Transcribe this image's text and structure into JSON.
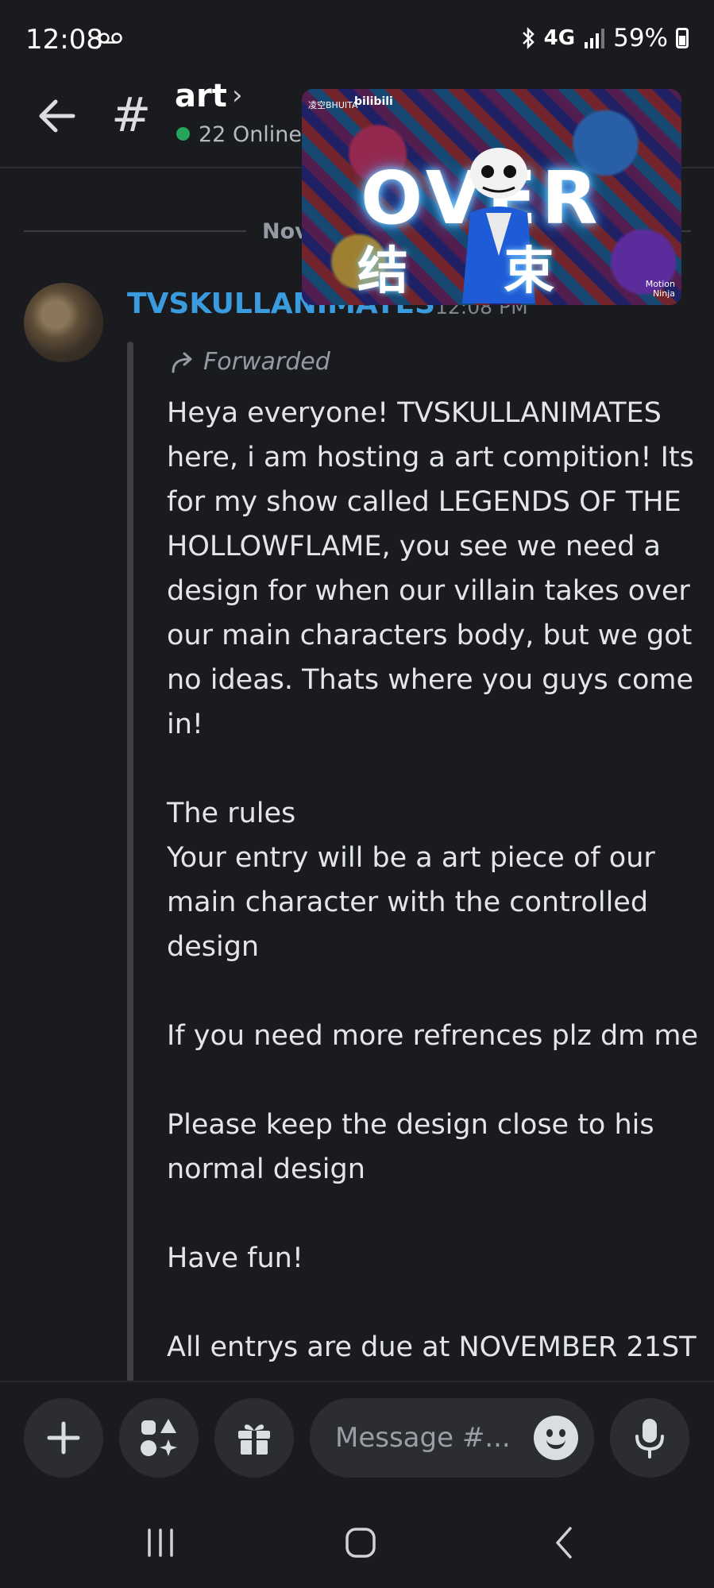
{
  "status_bar": {
    "time": "12:08",
    "network": "4G",
    "battery": "59%"
  },
  "header": {
    "channel_hash": "#",
    "channel_name": "art",
    "online_count": "22 Online"
  },
  "date_divider": "Nov",
  "pip_video": {
    "brand_small": "凌空BHUITA",
    "brand_logo": "bilibili",
    "big_text": "OVER",
    "cn_text": "结束",
    "watermark": "Motion Ninja"
  },
  "message": {
    "author": "TVSKULLANIMATES",
    "timestamp": "12:08 PM",
    "forwarded_label": "Forwarded",
    "body": "Heya everyone! TVSKULLANIMATES here, i am hosting a art compition! Its for my show called LEGENDS OF THE HOLLOWFLAME, you see we need a design for when our villain takes over our main characters body, but we got no ideas. Thats where you guys come in!\n\nThe rules\nYour entry will be a art piece of our main character with the controlled design\n\nIf you need more refrences plz dm me\n\nPlease keep the design close to his normal design\n\nHave fun!\n\nAll entrys are due at NOVEMBER 21ST"
  },
  "composer": {
    "placeholder": "Message #..."
  },
  "colors": {
    "background": "#1a1b1f",
    "author": "#3a9bde",
    "online": "#23a55a"
  }
}
